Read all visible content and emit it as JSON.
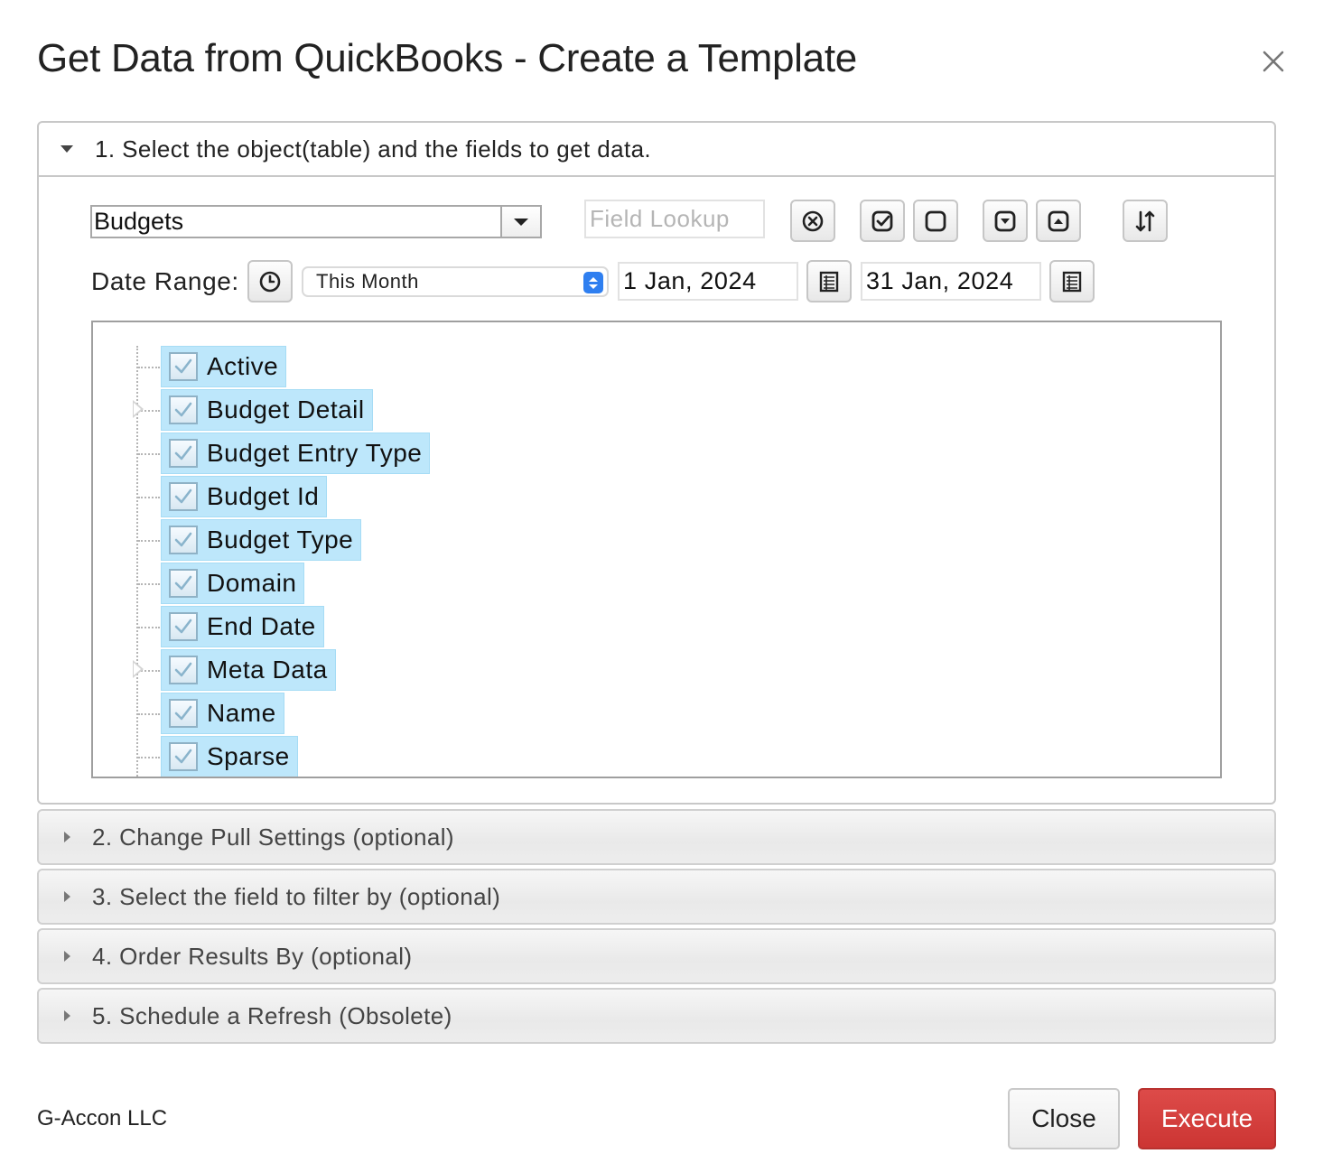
{
  "dialog": {
    "title": "Get Data from QuickBooks - Create a Template",
    "close_icon": "close-icon"
  },
  "section1": {
    "header": "1. Select the object(table) and the fields to get data.",
    "object_select": {
      "value": "Budgets"
    },
    "field_lookup": {
      "placeholder": "Field Lookup",
      "value": ""
    },
    "toolbar_icons": [
      "clear-circle-icon",
      "check-all-icon",
      "uncheck-all-icon",
      "expand-all-icon",
      "collapse-all-icon",
      "sort-icon"
    ],
    "date_range": {
      "label": "Date Range:",
      "preset": "This Month",
      "start": "1 Jan, 2024",
      "end": "31 Jan, 2024"
    },
    "fields": [
      {
        "label": "Active",
        "checked": true,
        "expandable": false
      },
      {
        "label": "Budget Detail",
        "checked": true,
        "expandable": true
      },
      {
        "label": "Budget Entry Type",
        "checked": true,
        "expandable": false
      },
      {
        "label": "Budget Id",
        "checked": true,
        "expandable": false
      },
      {
        "label": "Budget Type",
        "checked": true,
        "expandable": false
      },
      {
        "label": "Domain",
        "checked": true,
        "expandable": false
      },
      {
        "label": "End Date",
        "checked": true,
        "expandable": false
      },
      {
        "label": "Meta Data",
        "checked": true,
        "expandable": true
      },
      {
        "label": "Name",
        "checked": true,
        "expandable": false
      },
      {
        "label": "Sparse",
        "checked": true,
        "expandable": false
      }
    ]
  },
  "sections": [
    {
      "label": "2. Change Pull Settings (optional)"
    },
    {
      "label": "3. Select the field to filter by (optional)"
    },
    {
      "label": "4. Order Results By (optional)"
    },
    {
      "label": "5. Schedule a Refresh (Obsolete)"
    }
  ],
  "footer": {
    "company": "G-Accon LLC",
    "close_label": "Close",
    "execute_label": "Execute"
  },
  "colors": {
    "execute": "#d2403e",
    "selected_item": "#bde7fb",
    "stepper": "#2f7ff0"
  }
}
